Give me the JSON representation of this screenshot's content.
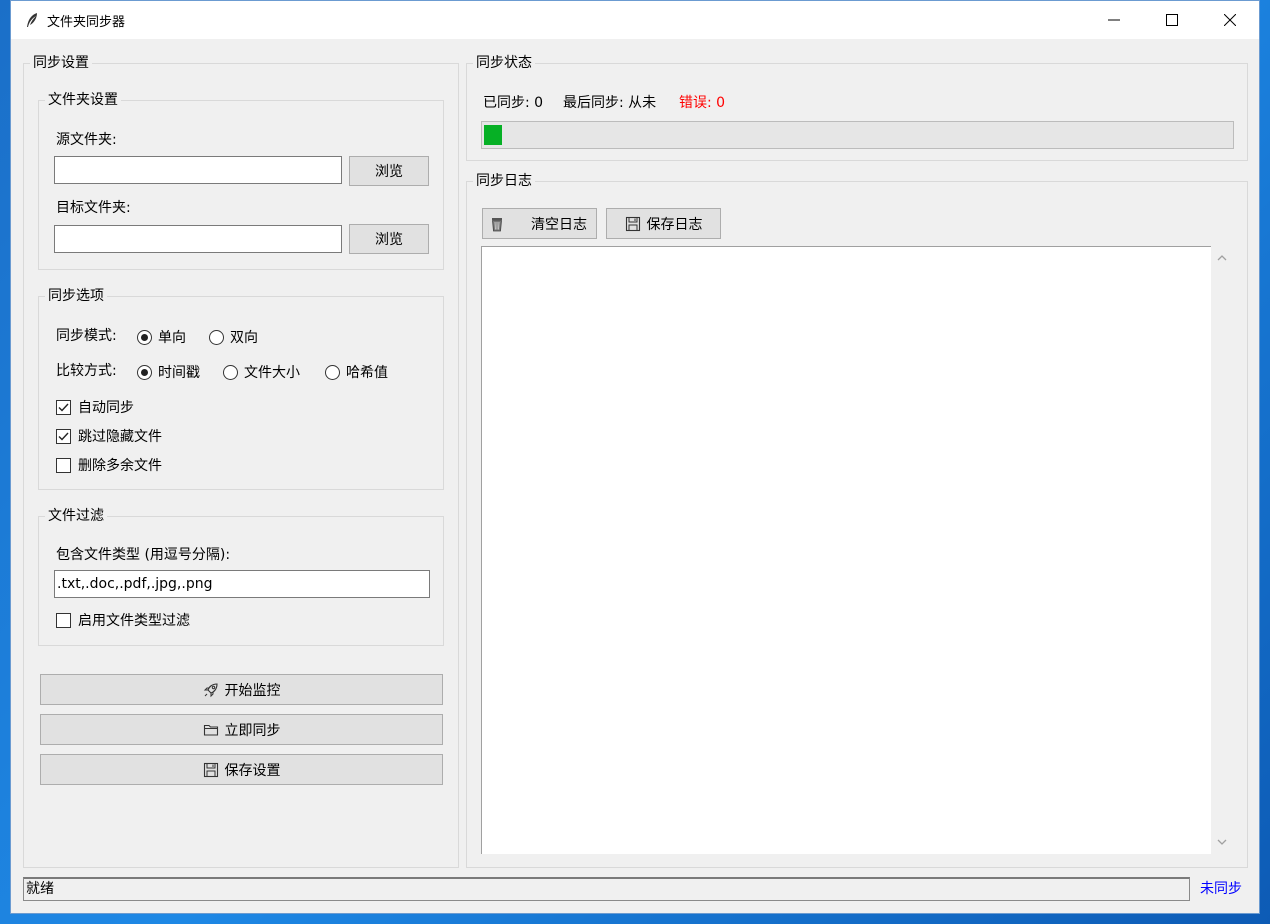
{
  "window": {
    "title": "文件夹同步器",
    "app_icon": "feather-icon",
    "controls": [
      "minimize-icon",
      "maximize-icon",
      "close-icon"
    ]
  },
  "settings": {
    "title": "同步设置",
    "folders": {
      "title": "文件夹设置",
      "source_label": "源文件夹:",
      "source_value": "",
      "browse_label": "浏览",
      "target_label": "目标文件夹:",
      "target_value": "",
      "browse2_label": "浏览"
    },
    "options": {
      "title": "同步选项",
      "mode_label": "同步模式:",
      "mode_options": [
        {
          "label": "单向",
          "selected": true
        },
        {
          "label": "双向",
          "selected": false
        }
      ],
      "compare_label": "比较方式:",
      "compare_options": [
        {
          "label": "时间戳",
          "selected": true
        },
        {
          "label": "文件大小",
          "selected": false
        },
        {
          "label": "哈希值",
          "selected": false
        }
      ],
      "checks": [
        {
          "label": "自动同步",
          "checked": true
        },
        {
          "label": "跳过隐藏文件",
          "checked": true
        },
        {
          "label": "删除多余文件",
          "checked": false
        }
      ]
    },
    "filter": {
      "title": "文件过滤",
      "types_label": "包含文件类型 (用逗号分隔):",
      "types_value": ".txt,.doc,.pdf,.jpg,.png",
      "enable_label": "启用文件类型过滤",
      "enable_checked": false
    },
    "actions": {
      "start_label": "开始监控",
      "start_icon": "rocket-icon",
      "sync_label": "立即同步",
      "sync_icon": "folder-icon",
      "save_label": "保存设置",
      "save_icon": "floppy-disk-icon"
    }
  },
  "status": {
    "title": "同步状态",
    "synced_text": "已同步: 0",
    "last_sync_text": "最后同步: 从未",
    "errors_text": "错误: 0",
    "error_color": "#ff0000",
    "progress_color": "#06b025",
    "progress_fraction": 0.017
  },
  "log": {
    "title": "同步日志",
    "clear_label": "清空日志",
    "clear_icon": "trash-icon",
    "save_label": "保存日志",
    "save_icon": "floppy-disk-icon",
    "content": ""
  },
  "statusbar": {
    "message": "就绪",
    "sync_state": "未同步",
    "sync_state_color": "#0000ff"
  }
}
